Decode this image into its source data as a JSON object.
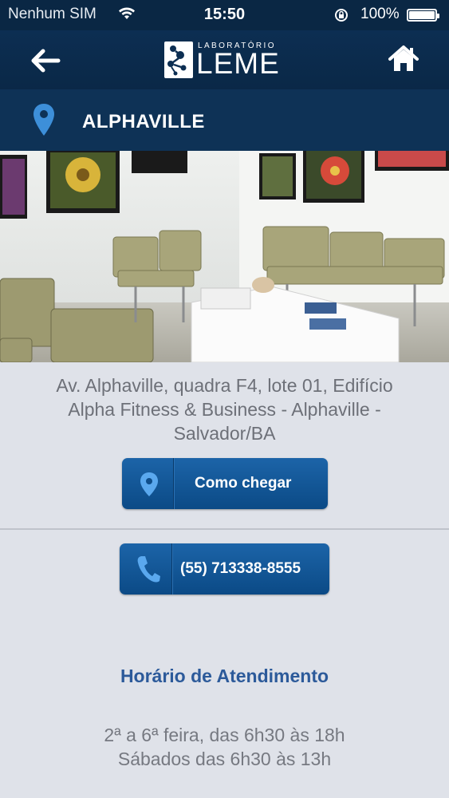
{
  "status_bar": {
    "carrier": "Nenhum SIM",
    "time": "15:50",
    "battery": "100%"
  },
  "nav": {
    "logo_sub": "LABORATÓRIO",
    "logo_brand": "LEME",
    "back_icon": "arrow-left-icon",
    "home_icon": "home-icon"
  },
  "location": {
    "name": "ALPHAVILLE",
    "icon": "map-pin-icon"
  },
  "address": {
    "line1": "Av. Alphaville, quadra F4, lote 01, Edifício",
    "line2": "Alpha Fitness & Business - Alphaville -",
    "line3": "Salvador/BA"
  },
  "actions": {
    "directions_label": "Como chegar",
    "phone_label": "(55) 713338-8555"
  },
  "hours": {
    "title": "Horário de Atendimento",
    "weekdays": "2ª a 6ª feira, das 6h30 às 18h",
    "saturday": "Sábados das 6h30 às 13h"
  },
  "colors": {
    "header": "#0a2847",
    "location_bar": "#0e3256",
    "button": "#0b4a86",
    "hours_title": "#2c5a9a"
  }
}
